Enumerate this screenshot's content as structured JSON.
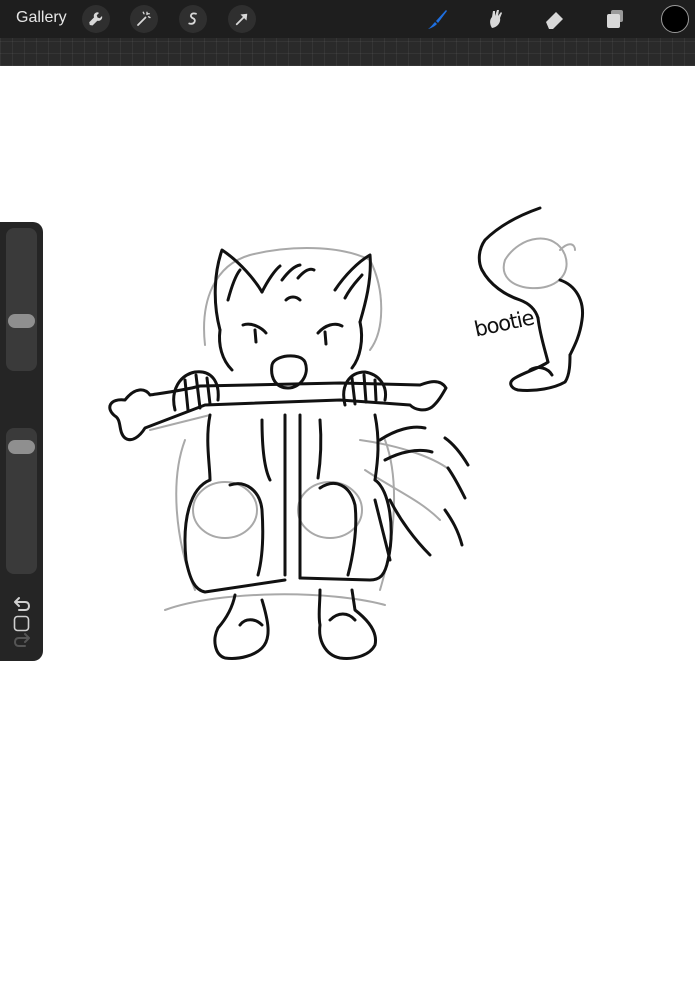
{
  "toolbar": {
    "gallery_label": "Gallery",
    "left_tools": [
      "wrench-icon",
      "magic-wand-icon",
      "selection-icon",
      "transform-arrow-icon"
    ],
    "right_tools": [
      "brush-icon",
      "smudge-icon",
      "eraser-icon",
      "layers-icon"
    ],
    "active_tool": "brush-icon",
    "active_color": "#1e6fe0",
    "current_color": "#000000"
  },
  "sidebar": {
    "brush_size_level": 0.33,
    "opacity_level": 0.92,
    "modify_icon": "square-icon",
    "undo_icon": "undo-icon",
    "redo_icon": "redo-icon"
  },
  "canvas": {
    "annotation_text": "bootie"
  }
}
